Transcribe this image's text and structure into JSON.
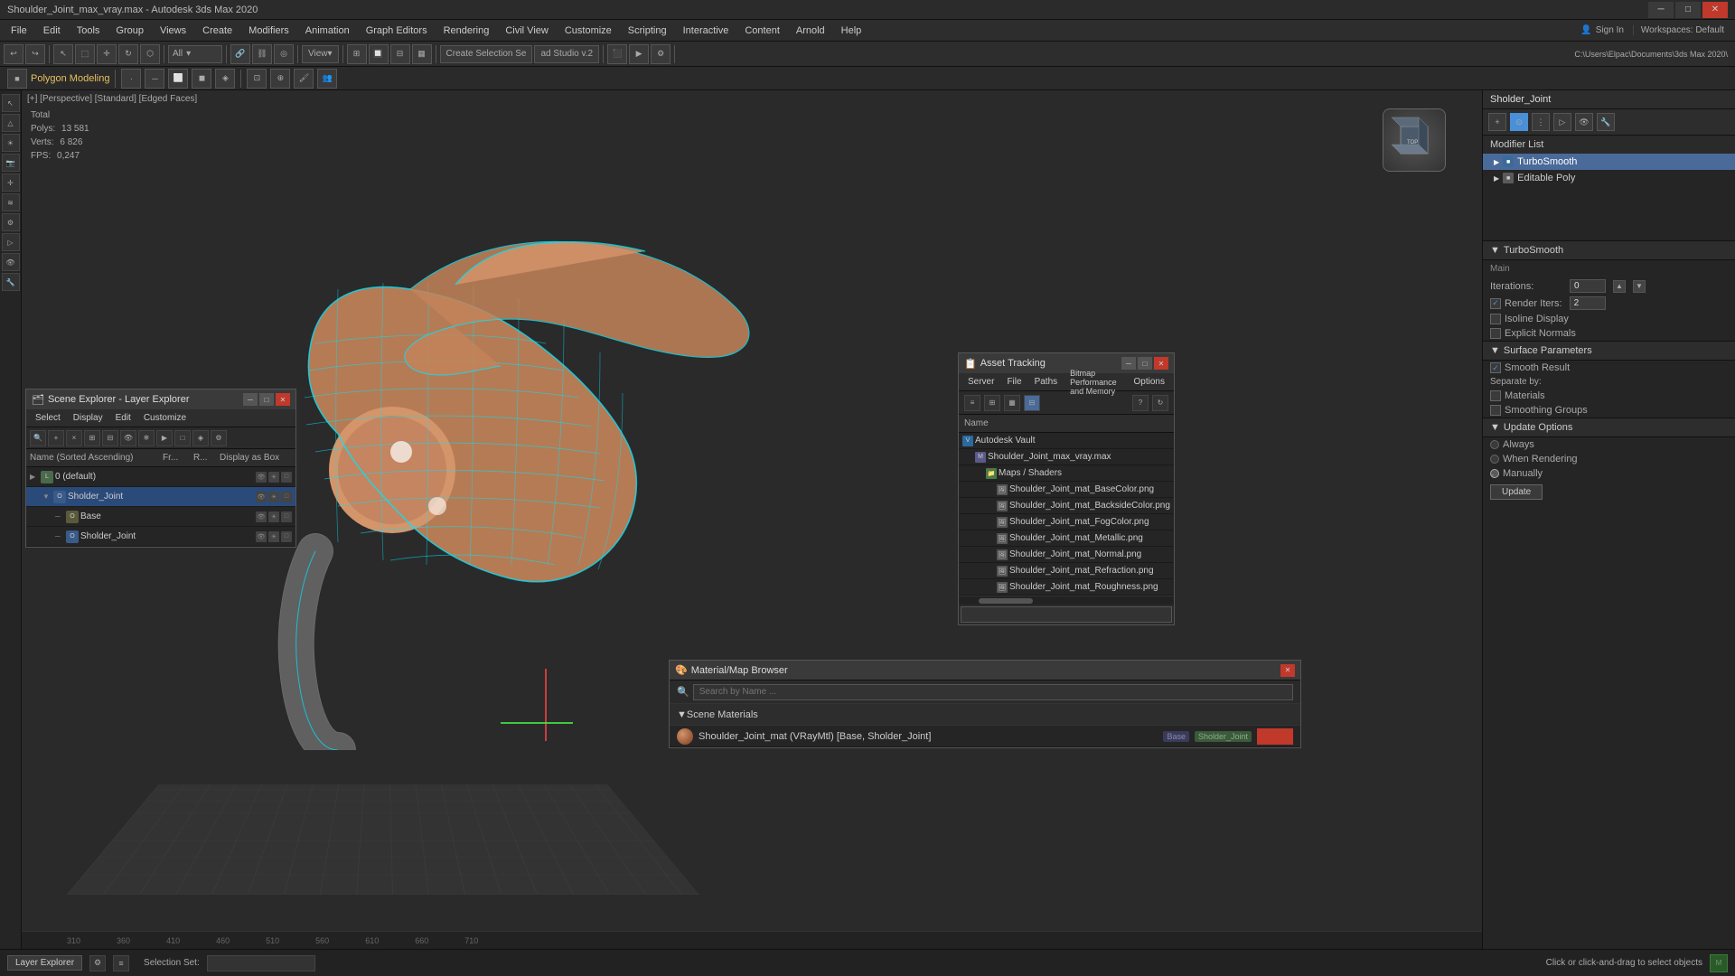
{
  "app": {
    "title": "Shoulder_Joint_max_vray.max - Autodesk 3ds Max 2020",
    "sign_in": "Sign In",
    "workspaces": "Workspaces: Default"
  },
  "menu": {
    "items": [
      "File",
      "Edit",
      "Tools",
      "Group",
      "Views",
      "Create",
      "Modifiers",
      "Animation",
      "Graph Editors",
      "Rendering",
      "Civil View",
      "Customize",
      "Scripting",
      "Interactive",
      "Content",
      "Arnold",
      "Help"
    ]
  },
  "toolbar": {
    "view_label": "View",
    "create_selection": "Create Selection Se",
    "ad_studio": "ad Studio v.2",
    "all_label": "All",
    "path_label": "C:\\Users\\Elpac\\Documents\\3ds Max 2020\\"
  },
  "secondary_toolbar": {
    "label": "Polygon Modeling"
  },
  "viewport": {
    "label": "[+] [Perspective] [Standard] [Edged Faces]",
    "stats": {
      "polys_label": "Polys:",
      "polys_value": "13 581",
      "verts_label": "Verts:",
      "verts_value": "6 826",
      "fps_label": "FPS:",
      "fps_value": "0,247",
      "total_label": "Total"
    }
  },
  "right_panel": {
    "object_name": "Sholder_Joint",
    "modifier_list_label": "Modifier List",
    "modifiers": [
      {
        "name": "TurboSmooth",
        "active": true
      },
      {
        "name": "Editable Poly",
        "active": false
      }
    ],
    "turbosmooth": {
      "label": "TurboSmooth",
      "main_label": "Main",
      "iterations_label": "Iterations:",
      "iterations_value": "0",
      "render_iters_label": "Render Iters:",
      "render_iters_value": "2",
      "isoline_display": "Isoline Display",
      "explicit_normals": "Explicit Normals"
    },
    "surface_params": {
      "label": "Surface Parameters",
      "smooth_result": "Smooth Result",
      "separate_by": "Separate by:",
      "materials": "Materials",
      "smoothing_groups": "Smoothing Groups"
    },
    "update_options": {
      "label": "Update Options",
      "always": "Always",
      "when_rendering": "When Rendering",
      "manually": "Manually",
      "update_btn": "Update"
    }
  },
  "scene_explorer": {
    "title": "Scene Explorer - Layer Explorer",
    "menu_items": [
      "Select",
      "Display",
      "Edit",
      "Customize"
    ],
    "col_headers": {
      "name": "Name (Sorted Ascending)",
      "fr": "Fr...",
      "r": "R...",
      "display_as_box": "Display as Box"
    },
    "rows": [
      {
        "indent": 0,
        "expand": false,
        "name": "0 (default)",
        "icon": "layer"
      },
      {
        "indent": 1,
        "expand": true,
        "name": "Sholder_Joint",
        "icon": "obj",
        "selected": true
      },
      {
        "indent": 2,
        "expand": false,
        "name": "Base",
        "icon": "obj"
      },
      {
        "indent": 2,
        "expand": false,
        "name": "Sholder_Joint",
        "icon": "obj"
      }
    ]
  },
  "asset_tracking": {
    "title": "Asset Tracking",
    "menu_items": [
      "Server",
      "File",
      "Paths",
      "Bitmap Performance and Memory",
      "Options"
    ],
    "col_header": "Name",
    "rows": [
      {
        "indent": 0,
        "name": "Autodesk Vault",
        "icon": "vault"
      },
      {
        "indent": 1,
        "name": "Shoulder_Joint_max_vray.max",
        "icon": "file"
      },
      {
        "indent": 2,
        "name": "Maps / Shaders",
        "icon": "folder"
      },
      {
        "indent": 3,
        "name": "Shoulder_Joint_mat_BaseColor.png",
        "icon": "img"
      },
      {
        "indent": 3,
        "name": "Shoulder_Joint_mat_BacksideColor.png",
        "icon": "img"
      },
      {
        "indent": 3,
        "name": "Shoulder_Joint_mat_FogColor.png",
        "icon": "img"
      },
      {
        "indent": 3,
        "name": "Shoulder_Joint_mat_Metallic.png",
        "icon": "img"
      },
      {
        "indent": 3,
        "name": "Shoulder_Joint_mat_Normal.png",
        "icon": "img"
      },
      {
        "indent": 3,
        "name": "Shoulder_Joint_mat_Refraction.png",
        "icon": "img"
      },
      {
        "indent": 3,
        "name": "Shoulder_Joint_mat_Roughness.png",
        "icon": "img"
      }
    ]
  },
  "material_browser": {
    "title": "Material/Map Browser",
    "search_placeholder": "Search by Name ...",
    "section": "Scene Materials",
    "item": {
      "name": "Shoulder_Joint_mat (VRayMtl) [Base, Sholder_Joint]",
      "tags": [
        "Base",
        "Sholder_Joint"
      ]
    }
  },
  "status_bar": {
    "mode": "Layer Explorer",
    "selection_set_label": "Selection Set:",
    "click_msg": "Click or click-and-drag to select objects"
  },
  "rulers": [
    "310",
    "360",
    "410",
    "460",
    "510",
    "560",
    "610",
    "660",
    "710"
  ]
}
